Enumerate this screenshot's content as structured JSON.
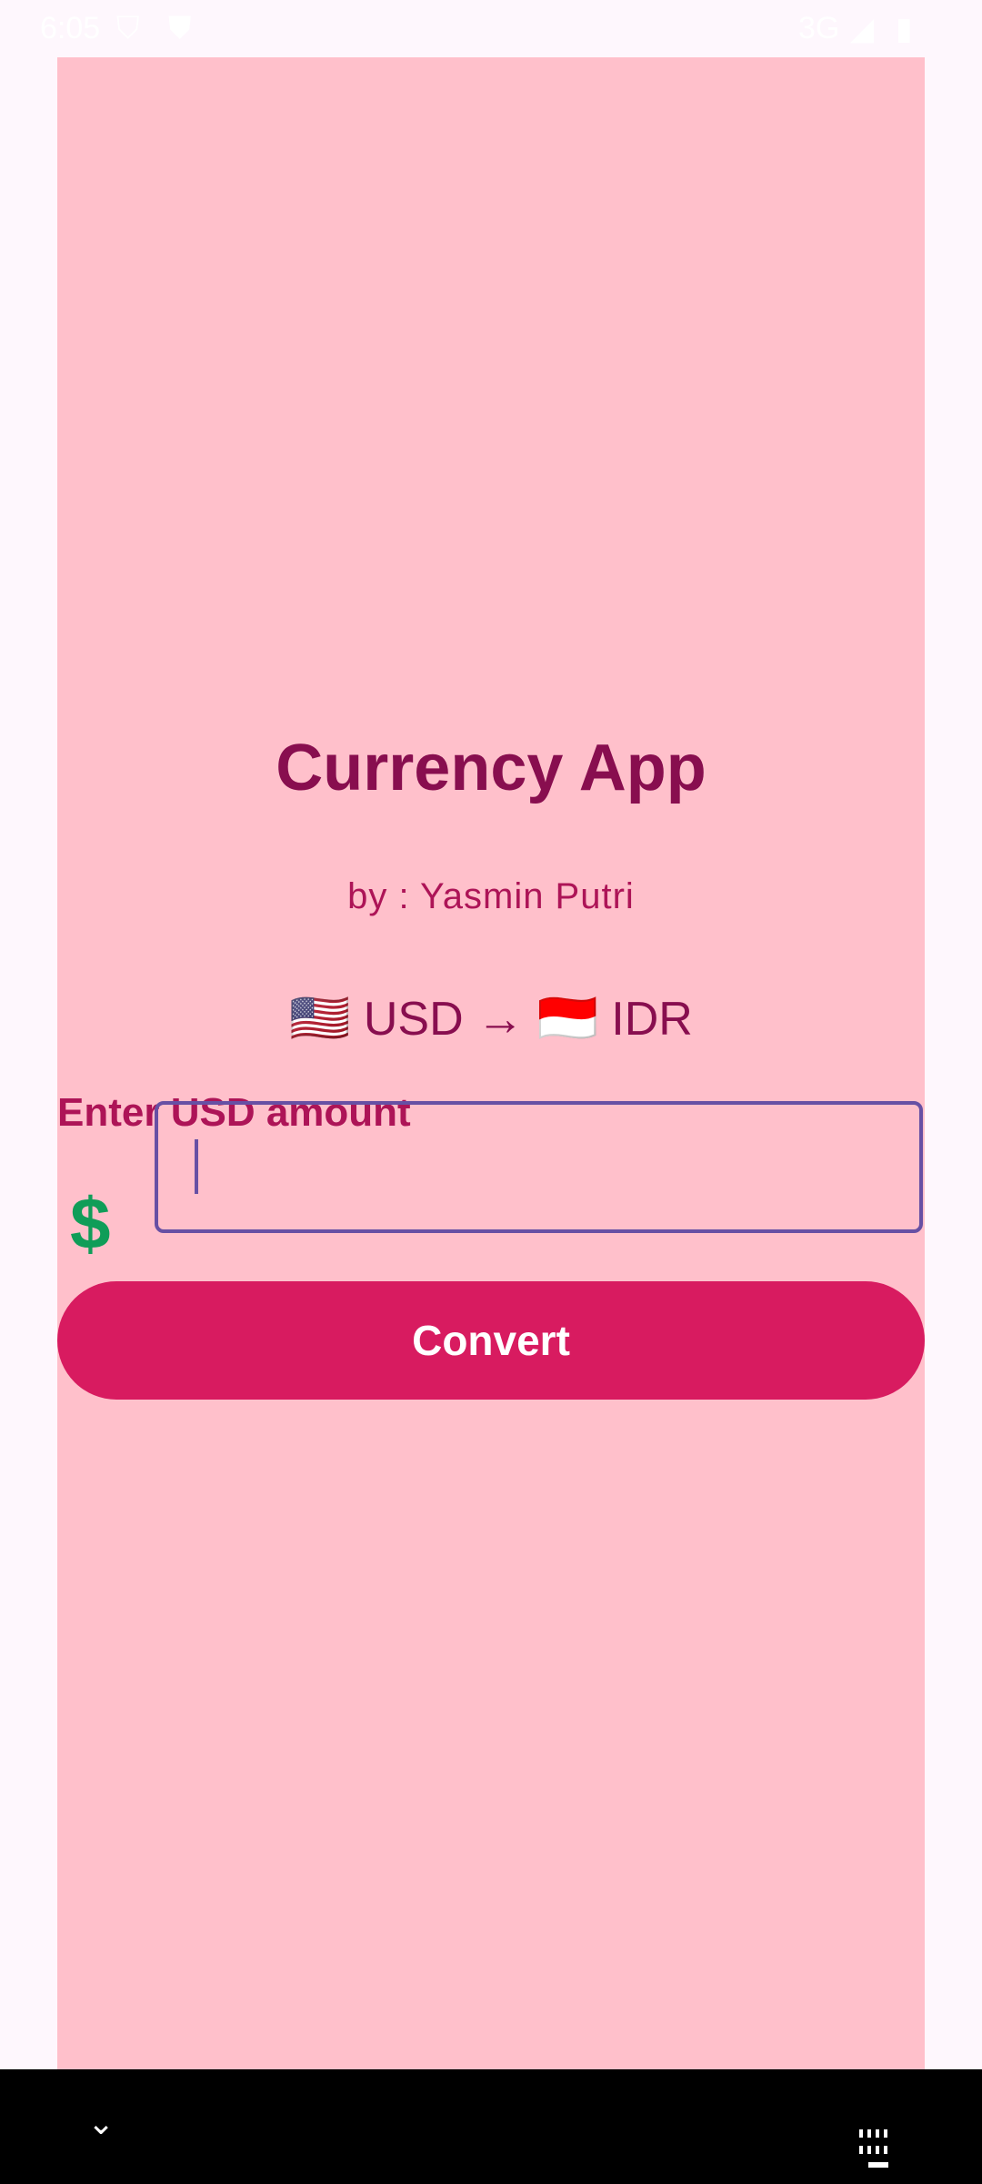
{
  "status_bar": {
    "time": "6:05",
    "network": "3G"
  },
  "app": {
    "title": "Currency App",
    "subtitle": "by : Yasmin Putri",
    "from_flag": "🇺🇸",
    "from_currency": "USD",
    "arrow": "→",
    "to_flag": "🇮🇩",
    "to_currency": "IDR",
    "input_label": "Enter USD amount",
    "currency_symbol": "💲",
    "amount_value": "",
    "convert_label": "Convert"
  },
  "colors": {
    "panel": "#FFC0CB",
    "title": "#880E4F",
    "accent": "#D81B60",
    "input_border": "#6750A4"
  },
  "nav_bar": {
    "left_icon": "chevron-down-icon",
    "right_icon": "keyboard-icon"
  }
}
